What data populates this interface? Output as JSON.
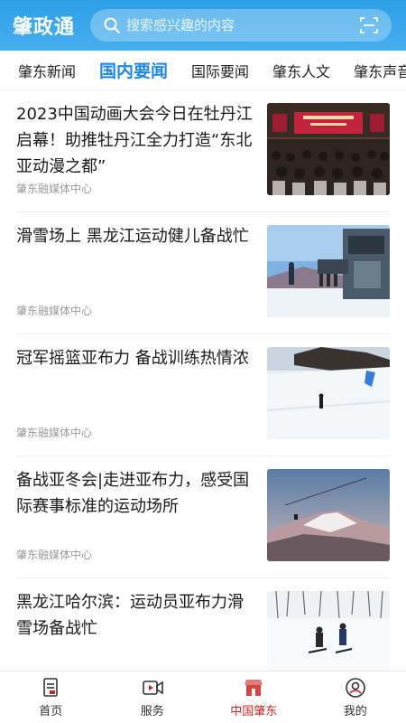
{
  "header": {
    "app_title": "肇政通",
    "search_placeholder": "搜索感兴趣的内容"
  },
  "tabs": [
    {
      "label": "肇东新闻"
    },
    {
      "label": "国内要闻"
    },
    {
      "label": "国际要闻"
    },
    {
      "label": "肇东人文"
    },
    {
      "label": "肇东声音"
    }
  ],
  "active_tab": "国内要闻",
  "news": [
    {
      "title": "2023中国动画大会今日在牡丹江启幕！助推牡丹江全力打造“东北亚动漫之都”",
      "source": "肇东融媒体中心"
    },
    {
      "title": "滑雪场上 黑龙江运动健儿备战忙",
      "source": "肇东融媒体中心"
    },
    {
      "title": "冠军摇篮亚布力 备战训练热情浓",
      "source": "肇东融媒体中心"
    },
    {
      "title": "备战亚冬会|走进亚布力，感受国际赛事标准的运动场所",
      "source": "肇东融媒体中心"
    },
    {
      "title": "黑龙江哈尔滨：运动员亚布力滑雪场备战忙",
      "source": ""
    }
  ],
  "bottom_nav": [
    {
      "label": "首页"
    },
    {
      "label": "服务"
    },
    {
      "label": "中国肇东"
    },
    {
      "label": "我的"
    }
  ],
  "colors": {
    "header": "#2f9fe6",
    "tab_active": "#1e88e5",
    "nav_active": "#c62828"
  }
}
